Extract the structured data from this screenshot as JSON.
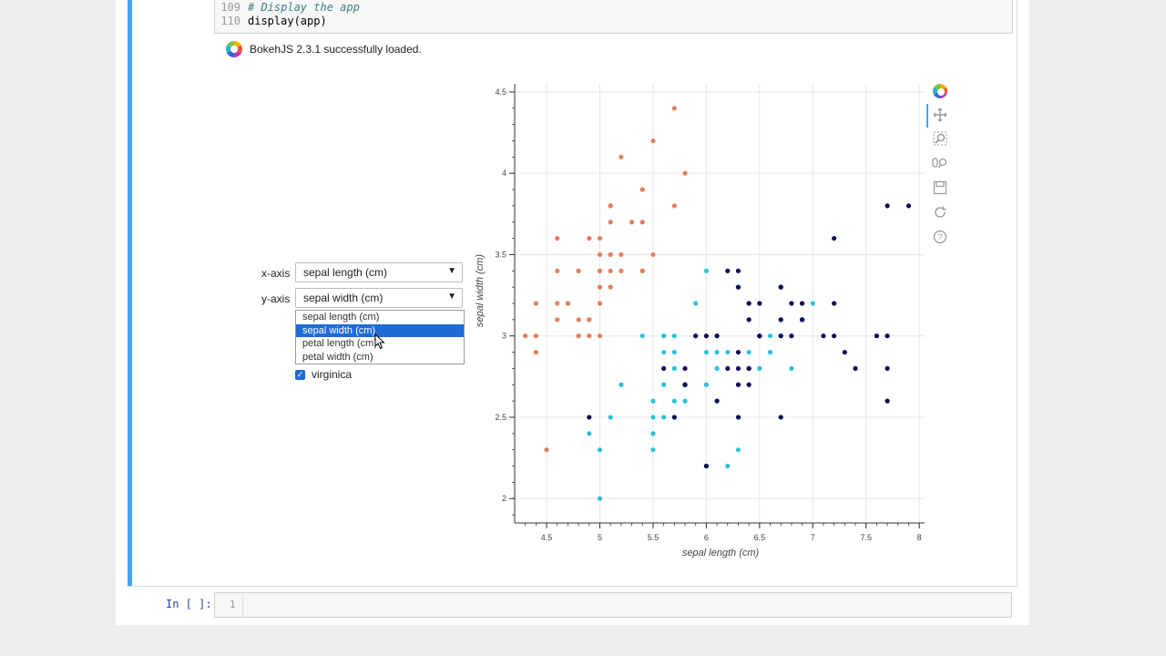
{
  "code": {
    "lines": [
      {
        "num": "109",
        "text": "# Display the app",
        "comment": true
      },
      {
        "num": "110",
        "text": "display(app)",
        "comment": false
      }
    ]
  },
  "output": {
    "bokeh_message": "BokehJS 2.3.1 successfully loaded."
  },
  "widgets": {
    "x_axis_label": "x-axis",
    "x_axis_value": "sepal length (cm)",
    "y_axis_label": "y-axis",
    "y_axis_value": "sepal width (cm)",
    "dropdown_options": [
      "sepal length (cm)",
      "sepal width (cm)",
      "petal length (cm)",
      "petal width (cm)"
    ],
    "dropdown_highlighted_index": 1,
    "checkbox_label": "virginica",
    "checkbox_checked": true
  },
  "toolbar": {
    "tools": [
      "bokeh-logo-icon",
      "pan-icon",
      "box-zoom-icon",
      "wheel-zoom-icon",
      "save-icon",
      "reset-icon",
      "help-icon"
    ]
  },
  "next_cell": {
    "prompt": "In [ ]:",
    "line_number": "1"
  },
  "colors": {
    "setosa": "#e0815f",
    "versicolor": "#2cc1dc",
    "virginica": "#0a0a55",
    "cell_bar": "#42a5f5"
  },
  "chart_data": {
    "type": "scatter",
    "xlabel": "sepal length (cm)",
    "ylabel": "sepal width (cm)",
    "xlim": [
      4.2,
      8.05
    ],
    "ylim": [
      1.85,
      4.55
    ],
    "xticks": [
      4.5,
      5,
      5.5,
      6,
      6.5,
      7,
      7.5,
      8
    ],
    "yticks": [
      2,
      2.5,
      3,
      3.5,
      4,
      4.5
    ],
    "grid": true,
    "series": [
      {
        "color": "#e0815f",
        "points": [
          [
            5.1,
            3.5
          ],
          [
            4.9,
            3.0
          ],
          [
            4.7,
            3.2
          ],
          [
            4.6,
            3.1
          ],
          [
            5.0,
            3.6
          ],
          [
            5.4,
            3.9
          ],
          [
            4.6,
            3.4
          ],
          [
            5.0,
            3.4
          ],
          [
            4.4,
            2.9
          ],
          [
            4.9,
            3.1
          ],
          [
            5.4,
            3.7
          ],
          [
            4.8,
            3.4
          ],
          [
            4.8,
            3.0
          ],
          [
            4.3,
            3.0
          ],
          [
            5.8,
            4.0
          ],
          [
            5.7,
            4.4
          ],
          [
            5.4,
            3.9
          ],
          [
            5.1,
            3.5
          ],
          [
            5.7,
            3.8
          ],
          [
            5.1,
            3.8
          ],
          [
            5.4,
            3.4
          ],
          [
            5.1,
            3.7
          ],
          [
            4.6,
            3.6
          ],
          [
            5.1,
            3.3
          ],
          [
            4.8,
            3.4
          ],
          [
            5.0,
            3.0
          ],
          [
            5.0,
            3.4
          ],
          [
            5.2,
            3.5
          ],
          [
            5.2,
            3.4
          ],
          [
            4.7,
            3.2
          ],
          [
            4.8,
            3.1
          ],
          [
            5.4,
            3.4
          ],
          [
            5.2,
            4.1
          ],
          [
            5.5,
            4.2
          ],
          [
            4.9,
            3.1
          ],
          [
            5.0,
            3.2
          ],
          [
            5.5,
            3.5
          ],
          [
            4.9,
            3.6
          ],
          [
            4.4,
            3.0
          ],
          [
            5.1,
            3.4
          ],
          [
            5.0,
            3.5
          ],
          [
            4.5,
            2.3
          ],
          [
            4.4,
            3.2
          ],
          [
            5.0,
            3.5
          ],
          [
            5.1,
            3.8
          ],
          [
            4.8,
            3.0
          ],
          [
            5.1,
            3.8
          ],
          [
            4.6,
            3.2
          ],
          [
            5.3,
            3.7
          ],
          [
            5.0,
            3.3
          ]
        ]
      },
      {
        "color": "#2cc1dc",
        "points": [
          [
            7.0,
            3.2
          ],
          [
            6.4,
            3.2
          ],
          [
            6.9,
            3.1
          ],
          [
            5.5,
            2.3
          ],
          [
            6.5,
            2.8
          ],
          [
            5.7,
            2.8
          ],
          [
            6.3,
            3.3
          ],
          [
            4.9,
            2.4
          ],
          [
            6.6,
            2.9
          ],
          [
            5.2,
            2.7
          ],
          [
            5.0,
            2.0
          ],
          [
            5.9,
            3.0
          ],
          [
            6.0,
            2.2
          ],
          [
            6.1,
            2.9
          ],
          [
            5.6,
            2.9
          ],
          [
            6.7,
            3.1
          ],
          [
            5.6,
            3.0
          ],
          [
            5.8,
            2.7
          ],
          [
            6.2,
            2.2
          ],
          [
            5.6,
            2.5
          ],
          [
            5.9,
            3.2
          ],
          [
            6.1,
            2.8
          ],
          [
            6.3,
            2.5
          ],
          [
            6.1,
            2.8
          ],
          [
            6.4,
            2.9
          ],
          [
            6.6,
            3.0
          ],
          [
            6.8,
            2.8
          ],
          [
            6.7,
            3.0
          ],
          [
            6.0,
            2.9
          ],
          [
            5.7,
            2.6
          ],
          [
            5.5,
            2.4
          ],
          [
            5.5,
            2.4
          ],
          [
            5.8,
            2.7
          ],
          [
            6.0,
            2.7
          ],
          [
            5.4,
            3.0
          ],
          [
            6.0,
            3.4
          ],
          [
            6.7,
            3.1
          ],
          [
            6.3,
            2.3
          ],
          [
            5.6,
            3.0
          ],
          [
            5.5,
            2.5
          ],
          [
            5.5,
            2.6
          ],
          [
            6.1,
            3.0
          ],
          [
            5.8,
            2.6
          ],
          [
            5.0,
            2.3
          ],
          [
            5.6,
            2.7
          ],
          [
            5.7,
            3.0
          ],
          [
            5.7,
            2.9
          ],
          [
            6.2,
            2.9
          ],
          [
            5.1,
            2.5
          ],
          [
            5.7,
            2.8
          ]
        ]
      },
      {
        "color": "#0a0a55",
        "points": [
          [
            6.3,
            3.3
          ],
          [
            5.8,
            2.7
          ],
          [
            7.1,
            3.0
          ],
          [
            6.3,
            2.9
          ],
          [
            6.5,
            3.0
          ],
          [
            7.6,
            3.0
          ],
          [
            4.9,
            2.5
          ],
          [
            7.3,
            2.9
          ],
          [
            6.7,
            2.5
          ],
          [
            7.2,
            3.6
          ],
          [
            6.5,
            3.2
          ],
          [
            6.4,
            2.7
          ],
          [
            6.8,
            3.0
          ],
          [
            5.7,
            2.5
          ],
          [
            5.8,
            2.8
          ],
          [
            6.4,
            3.2
          ],
          [
            6.5,
            3.0
          ],
          [
            7.7,
            3.8
          ],
          [
            7.7,
            2.6
          ],
          [
            6.0,
            2.2
          ],
          [
            6.9,
            3.2
          ],
          [
            5.6,
            2.8
          ],
          [
            7.7,
            2.8
          ],
          [
            6.3,
            2.7
          ],
          [
            6.7,
            3.3
          ],
          [
            7.2,
            3.2
          ],
          [
            6.2,
            2.8
          ],
          [
            6.1,
            3.0
          ],
          [
            6.4,
            2.8
          ],
          [
            7.2,
            3.0
          ],
          [
            7.4,
            2.8
          ],
          [
            7.9,
            3.8
          ],
          [
            6.4,
            2.8
          ],
          [
            6.3,
            2.8
          ],
          [
            6.1,
            2.6
          ],
          [
            7.7,
            3.0
          ],
          [
            6.3,
            3.4
          ],
          [
            6.4,
            3.1
          ],
          [
            6.0,
            3.0
          ],
          [
            6.9,
            3.1
          ],
          [
            6.7,
            3.1
          ],
          [
            6.9,
            3.1
          ],
          [
            5.8,
            2.7
          ],
          [
            6.8,
            3.2
          ],
          [
            6.7,
            3.3
          ],
          [
            6.7,
            3.0
          ],
          [
            6.3,
            2.5
          ],
          [
            6.5,
            3.0
          ],
          [
            6.2,
            3.4
          ],
          [
            5.9,
            3.0
          ]
        ]
      }
    ]
  }
}
